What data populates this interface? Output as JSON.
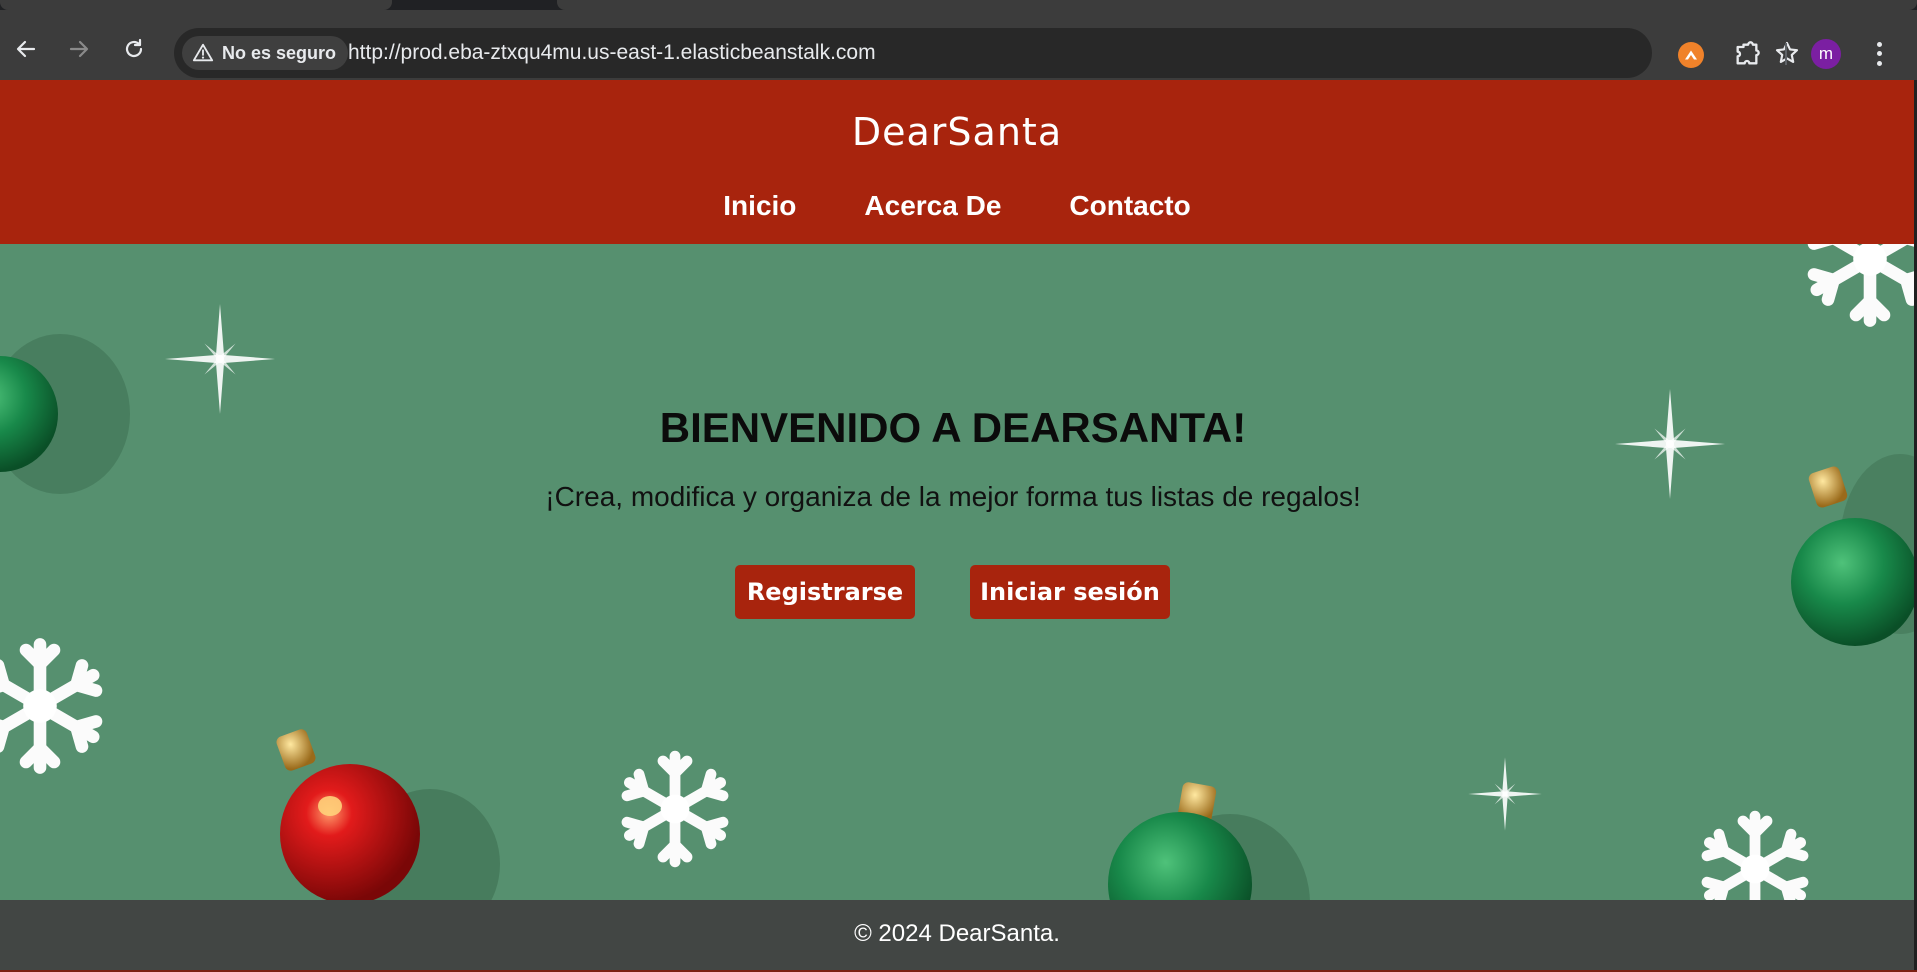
{
  "browser": {
    "security_label": "No es seguro",
    "url": "http://prod.eba-ztxqu4mu.us-east-1.elasticbeanstalk.com",
    "profile_initial": "m"
  },
  "site": {
    "brand": "DearSanta",
    "nav": [
      "Inicio",
      "Acerca De",
      "Contacto"
    ],
    "hero": {
      "title": "BIENVENIDO A DEARSANTA!",
      "subtitle": "¡Crea, modifica y organiza de la mejor forma tus listas de regalos!",
      "register_label": "Registrarse",
      "login_label": "Iniciar sesión"
    },
    "footer": "© 2024 DearSanta."
  },
  "colors": {
    "header": "#a8240d",
    "background": "#56906f",
    "footer": "#404040"
  },
  "icons": [
    "back-icon",
    "forward-icon",
    "reload-icon",
    "warning-icon",
    "bookmark-star-icon",
    "extension-icon",
    "puzzle-icon",
    "menu-icon"
  ]
}
